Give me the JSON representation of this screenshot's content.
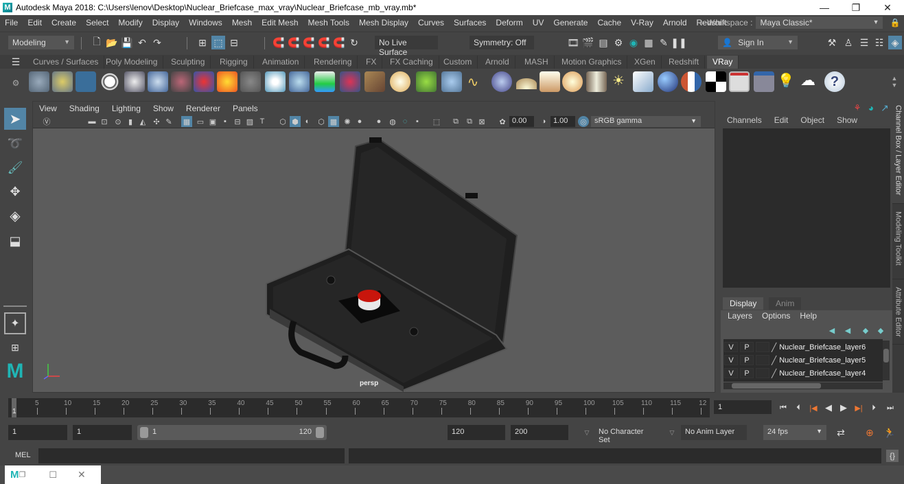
{
  "app": {
    "title": "Autodesk Maya 2018: C:\\Users\\lenov\\Desktop\\Nuclear_Briefcase_max_vray\\Nuclear_Briefcase_mb_vray.mb*",
    "logo": "M",
    "window_controls": {
      "minimize": "—",
      "restore": "❐",
      "close": "✕"
    }
  },
  "menubar": {
    "items": [
      "File",
      "Edit",
      "Create",
      "Select",
      "Modify",
      "Display",
      "Windows",
      "Mesh",
      "Edit Mesh",
      "Mesh Tools",
      "Mesh Display",
      "Curves",
      "Surfaces",
      "Deform",
      "UV",
      "Generate",
      "Cache",
      "V-Ray",
      "Arnold",
      "Redshift"
    ],
    "workspace_label": "» Workspace :",
    "workspace_value": "Maya Classic*"
  },
  "status_line": {
    "menu_set": "Modeling",
    "live_surface": "No Live Surface",
    "symmetry": "Symmetry: Off",
    "sign_in": "Sign In"
  },
  "shelf": {
    "tabs": [
      "Curves / Surfaces",
      "Poly Modeling",
      "Sculpting",
      "Rigging",
      "Animation",
      "Rendering",
      "FX",
      "FX Caching",
      "Custom",
      "Arnold",
      "MASH",
      "Motion Graphics",
      "XGen",
      "Redshift",
      "VRay"
    ],
    "active_tab": "VRay",
    "icons": [
      "vray-save-icon",
      "vray-load-icon",
      "vray-settings-icon",
      "vray-logo-icon",
      "vray-frame-buffer-icon",
      "vray-material-icon",
      "vray-camera-icon",
      "vray-blend-icon",
      "vray-fire-icon",
      "vray-proxy-icon",
      "vray-sphere-fade-icon",
      "vray-cone-icon",
      "vray-vrscene-icon",
      "vray-hair-icon",
      "vray-texture-icon",
      "vray-dome-light-icon",
      "vray-fur-icon",
      "vray-clipper-icon",
      "vray-curve-icon",
      "vray-sphere-icon",
      "vray-ies-light-icon",
      "vray-rect-light-icon",
      "vray-sphere-light-icon",
      "vray-cone-light-icon",
      "vray-sun-icon",
      "vray-plane-icon",
      "vray-ball-icon",
      "vray-mtl-icon",
      "vray-checker-icon",
      "vray-render-view-icon",
      "vray-settings-panel-icon",
      "vray-light-lister-icon",
      "vray-cloud-icon",
      "vray-help-icon"
    ]
  },
  "viewport": {
    "menu": [
      "View",
      "Shading",
      "Lighting",
      "Show",
      "Renderer",
      "Panels"
    ],
    "exposure": "0.00",
    "gamma": "1.00",
    "color_space": "sRGB gamma",
    "camera_label": "persp"
  },
  "channel_box": {
    "menu": [
      "Channels",
      "Edit",
      "Object",
      "Show"
    ]
  },
  "layer_editor": {
    "tabs": [
      "Display",
      "Anim"
    ],
    "active_tab": "Display",
    "menu": [
      "Layers",
      "Options",
      "Help"
    ],
    "layers": [
      {
        "v": "V",
        "p": "P",
        "name": "Nuclear_Briefcase_layer6"
      },
      {
        "v": "V",
        "p": "P",
        "name": "Nuclear_Briefcase_layer5"
      },
      {
        "v": "V",
        "p": "P",
        "name": "Nuclear_Briefcase_layer4"
      }
    ]
  },
  "side_tabs": [
    "Channel Box / Layer Editor",
    "Modeling Toolkit",
    "Attribute Editor"
  ],
  "time_slider": {
    "ticks": [
      "5",
      "10",
      "15",
      "20",
      "25",
      "30",
      "35",
      "40",
      "45",
      "50",
      "55",
      "60",
      "65",
      "70",
      "75",
      "80",
      "85",
      "90",
      "95",
      "100",
      "105",
      "110",
      "115",
      "12"
    ],
    "current_frame_marker": "1",
    "current_frame": "1"
  },
  "range_slider": {
    "start_time": "1",
    "playback_start": "1",
    "range_min": "1",
    "range_max": "120",
    "playback_end": "120",
    "end_time": "200",
    "character_set": "No Character Set",
    "anim_layer": "No Anim Layer",
    "fps": "24 fps"
  },
  "command_line": {
    "label": "MEL",
    "value": ""
  },
  "taskbar": {
    "icons": [
      "maya-icon",
      "restore-icon",
      "maximize-icon",
      "close-icon"
    ]
  },
  "colors": {
    "accent": "#5285a6",
    "background": "#444444",
    "viewport": "#5c5c5c",
    "maya_teal": "#1fb5b5",
    "button_red": "#c8150c"
  }
}
